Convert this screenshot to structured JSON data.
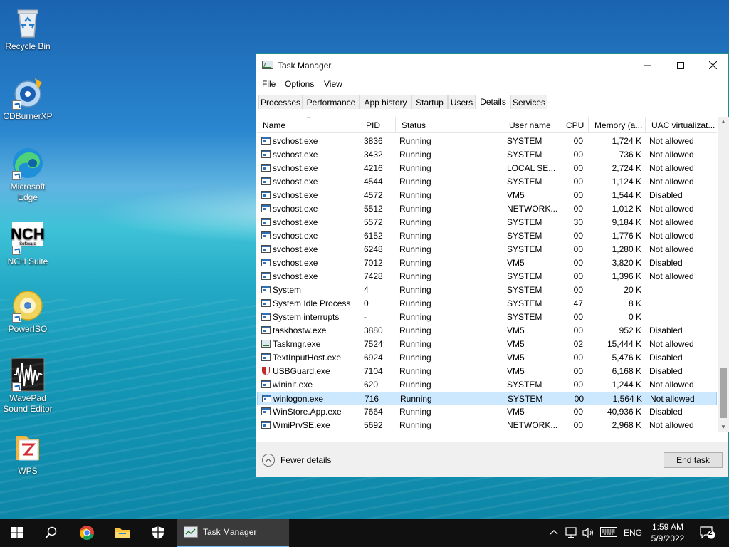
{
  "desktop": {
    "icons": [
      {
        "label": "Recycle Bin",
        "icon": "recycle-bin-icon"
      },
      {
        "label": "CDBurnerXP",
        "icon": "cd-burner-icon"
      },
      {
        "label": "Microsoft Edge",
        "icon": "edge-icon"
      },
      {
        "label": "NCH Suite",
        "icon": "nch-icon"
      },
      {
        "label": "PowerISO",
        "icon": "poweriso-icon"
      },
      {
        "label": "WavePad Sound Editor",
        "icon": "wavepad-icon"
      },
      {
        "label": "WPS",
        "icon": "wps-icon"
      }
    ],
    "nch_logo_text": "NCH",
    "nch_logo_sub": "Software"
  },
  "window": {
    "title": "Task Manager",
    "menu": [
      "File",
      "Options",
      "View"
    ],
    "tabs": [
      "Processes",
      "Performance",
      "App history",
      "Startup",
      "Users",
      "Details",
      "Services"
    ],
    "active_tab": "Details",
    "columns": [
      "Name",
      "PID",
      "Status",
      "User name",
      "CPU",
      "Memory (a...",
      "UAC virtualizat..."
    ],
    "sort_arrow": "^",
    "rows": [
      {
        "name": "svchost.exe",
        "pid": "3836",
        "status": "Running",
        "user": "SYSTEM",
        "cpu": "00",
        "mem": "1,724 K",
        "uac": "Not allowed"
      },
      {
        "name": "svchost.exe",
        "pid": "3432",
        "status": "Running",
        "user": "SYSTEM",
        "cpu": "00",
        "mem": "736 K",
        "uac": "Not allowed"
      },
      {
        "name": "svchost.exe",
        "pid": "4216",
        "status": "Running",
        "user": "LOCAL SE...",
        "cpu": "00",
        "mem": "2,724 K",
        "uac": "Not allowed"
      },
      {
        "name": "svchost.exe",
        "pid": "4544",
        "status": "Running",
        "user": "SYSTEM",
        "cpu": "00",
        "mem": "1,124 K",
        "uac": "Not allowed"
      },
      {
        "name": "svchost.exe",
        "pid": "4572",
        "status": "Running",
        "user": "VM5",
        "cpu": "00",
        "mem": "1,544 K",
        "uac": "Disabled"
      },
      {
        "name": "svchost.exe",
        "pid": "5512",
        "status": "Running",
        "user": "NETWORK...",
        "cpu": "00",
        "mem": "1,012 K",
        "uac": "Not allowed"
      },
      {
        "name": "svchost.exe",
        "pid": "5572",
        "status": "Running",
        "user": "SYSTEM",
        "cpu": "30",
        "mem": "9,184 K",
        "uac": "Not allowed"
      },
      {
        "name": "svchost.exe",
        "pid": "6152",
        "status": "Running",
        "user": "SYSTEM",
        "cpu": "00",
        "mem": "1,776 K",
        "uac": "Not allowed"
      },
      {
        "name": "svchost.exe",
        "pid": "6248",
        "status": "Running",
        "user": "SYSTEM",
        "cpu": "00",
        "mem": "1,280 K",
        "uac": "Not allowed"
      },
      {
        "name": "svchost.exe",
        "pid": "7012",
        "status": "Running",
        "user": "VM5",
        "cpu": "00",
        "mem": "3,820 K",
        "uac": "Disabled"
      },
      {
        "name": "svchost.exe",
        "pid": "7428",
        "status": "Running",
        "user": "SYSTEM",
        "cpu": "00",
        "mem": "1,396 K",
        "uac": "Not allowed"
      },
      {
        "name": "System",
        "pid": "4",
        "status": "Running",
        "user": "SYSTEM",
        "cpu": "00",
        "mem": "20 K",
        "uac": ""
      },
      {
        "name": "System Idle Process",
        "pid": "0",
        "status": "Running",
        "user": "SYSTEM",
        "cpu": "47",
        "mem": "8 K",
        "uac": ""
      },
      {
        "name": "System interrupts",
        "pid": "-",
        "status": "Running",
        "user": "SYSTEM",
        "cpu": "00",
        "mem": "0 K",
        "uac": ""
      },
      {
        "name": "taskhostw.exe",
        "pid": "3880",
        "status": "Running",
        "user": "VM5",
        "cpu": "00",
        "mem": "952 K",
        "uac": "Disabled"
      },
      {
        "name": "Taskmgr.exe",
        "pid": "7524",
        "status": "Running",
        "user": "VM5",
        "cpu": "02",
        "mem": "15,444 K",
        "uac": "Not allowed"
      },
      {
        "name": "TextInputHost.exe",
        "pid": "6924",
        "status": "Running",
        "user": "VM5",
        "cpu": "00",
        "mem": "5,476 K",
        "uac": "Disabled"
      },
      {
        "name": "USBGuard.exe",
        "pid": "7104",
        "status": "Running",
        "user": "VM5",
        "cpu": "00",
        "mem": "6,168 K",
        "uac": "Disabled"
      },
      {
        "name": "wininit.exe",
        "pid": "620",
        "status": "Running",
        "user": "SYSTEM",
        "cpu": "00",
        "mem": "1,244 K",
        "uac": "Not allowed"
      },
      {
        "name": "winlogon.exe",
        "pid": "716",
        "status": "Running",
        "user": "SYSTEM",
        "cpu": "00",
        "mem": "1,564 K",
        "uac": "Not allowed"
      },
      {
        "name": "WinStore.App.exe",
        "pid": "7664",
        "status": "Running",
        "user": "VM5",
        "cpu": "00",
        "mem": "40,936 K",
        "uac": "Disabled"
      },
      {
        "name": "WmiPrvSE.exe",
        "pid": "5692",
        "status": "Running",
        "user": "NETWORK...",
        "cpu": "00",
        "mem": "2,968 K",
        "uac": "Not allowed"
      }
    ],
    "selected_row_name": "winlogon.exe",
    "fewer_details": "Fewer details",
    "end_task": "End task"
  },
  "taskbar": {
    "active_app": "Task Manager",
    "lang": "ENG",
    "time": "1:59 AM",
    "date": "5/9/2022",
    "notifications": "2"
  },
  "colors": {
    "title_accent": "#1c8c8c",
    "selection": "#cce8ff",
    "taskbar": "#101010"
  }
}
